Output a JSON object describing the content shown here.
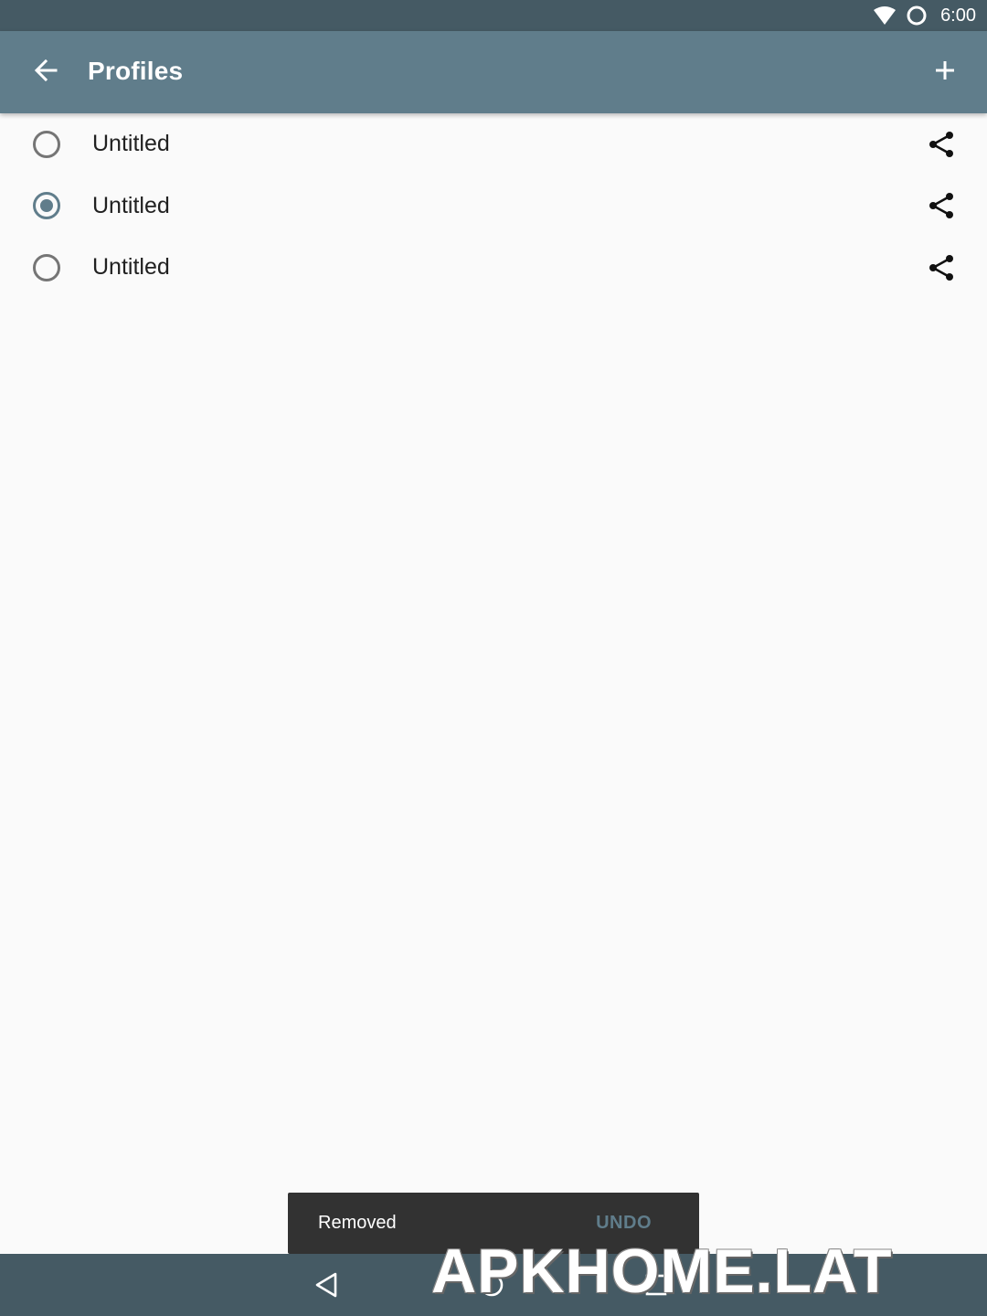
{
  "status_bar": {
    "time": "6:00",
    "icons": [
      "wifi-icon",
      "circle-status-icon"
    ]
  },
  "toolbar": {
    "title": "Profiles",
    "back_icon": "arrow-left-icon",
    "add_icon": "plus-icon"
  },
  "profiles": [
    {
      "name": "Untitled",
      "selected": false
    },
    {
      "name": "Untitled",
      "selected": true
    },
    {
      "name": "Untitled",
      "selected": false
    }
  ],
  "snackbar": {
    "message": "Removed",
    "action": "UNDO"
  },
  "nav_bar": {
    "icons": [
      "nav-back-icon",
      "nav-home-icon",
      "nav-recents-icon"
    ]
  },
  "watermark": {
    "text": "APKHOME.LAT"
  },
  "colors": {
    "status_bar": "#455a64",
    "toolbar": "#607d8b",
    "accent": "#607d8b",
    "background": "#fafafa",
    "snackbar": "#323232"
  }
}
